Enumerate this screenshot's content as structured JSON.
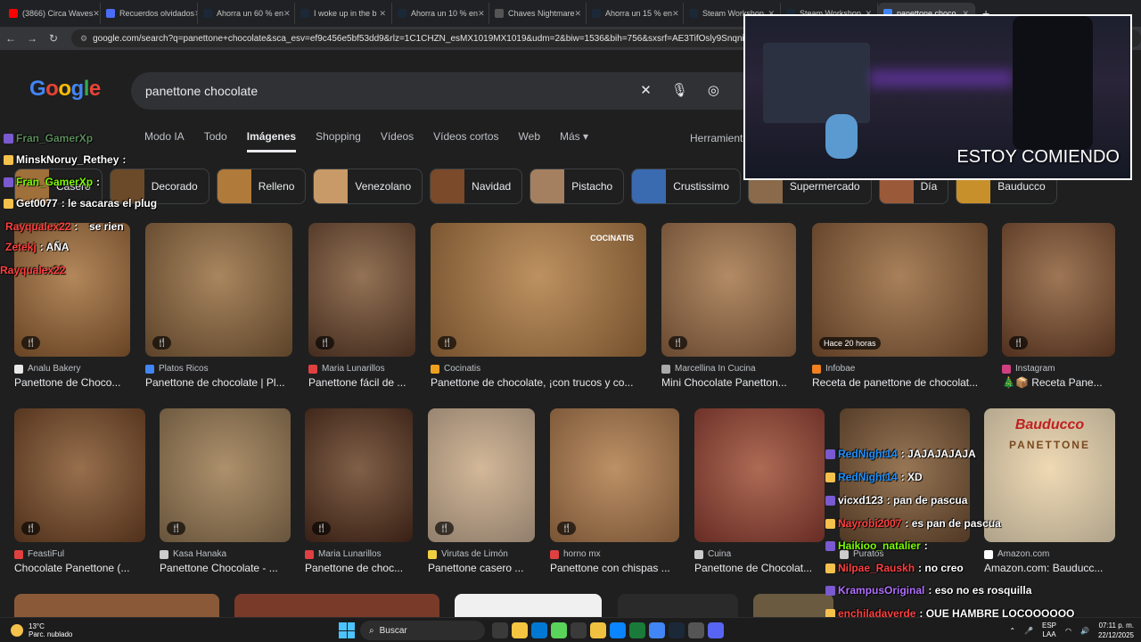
{
  "browser": {
    "tabs": [
      {
        "label": "(3866) Circa Waves",
        "color": "#ff0000"
      },
      {
        "label": "Recuerdos olvidados",
        "color": "#4a6cf7"
      },
      {
        "label": "Ahorra un 60 % en",
        "color": "#1b2838"
      },
      {
        "label": "I woke up in the b",
        "color": "#1b2838"
      },
      {
        "label": "Ahorra un 10 % en",
        "color": "#1b2838"
      },
      {
        "label": "Chaves Nightmare",
        "color": "#555555"
      },
      {
        "label": "Ahorra un 15 % en",
        "color": "#1b2838"
      },
      {
        "label": "Steam Workshop",
        "color": "#1b2838"
      },
      {
        "label": "Steam Workshop",
        "color": "#1b2838"
      },
      {
        "label": "panettone choco",
        "color": "#4285f4"
      }
    ],
    "url": "google.com/search?q=panettone+chocolate&sca_esv=ef9c456e5bf53dd9&rlz=1C1CHZN_esMX1019MX1019&udm=2&biw=1536&bih=756&sxsrf=AE3TifOsly9SnqnipYulXe1Eus"
  },
  "google": {
    "logo": "Google",
    "query": "panettone chocolate",
    "tabs": [
      "Modo IA",
      "Todo",
      "Imágenes",
      "Shopping",
      "Vídeos",
      "Vídeos cortos",
      "Web",
      "Más ▾"
    ],
    "tools": "Herramientas",
    "chips": [
      {
        "label": "Casero",
        "color": "#a0703a"
      },
      {
        "label": "Decorado",
        "color": "#6b4a2a"
      },
      {
        "label": "Relleno",
        "color": "#b07a3a"
      },
      {
        "label": "Venezolano",
        "color": "#c89a68"
      },
      {
        "label": "Navidad",
        "color": "#7a4a2a"
      },
      {
        "label": "Pistacho",
        "color": "#a48060"
      },
      {
        "label": "Crustissimo",
        "color": "#3a6ab0"
      },
      {
        "label": "Supermercado",
        "color": "#8a6a4a"
      },
      {
        "label": "Día",
        "color": "#9a5a3a"
      },
      {
        "label": "Bauducco",
        "color": "#c8902a"
      }
    ],
    "row1": [
      {
        "source": "Analu Bakery",
        "title": "Panettone de Choco...",
        "color": "#8a5a30",
        "src_color": "#e8e8e8",
        "badge": ""
      },
      {
        "source": "Platos Ricos",
        "title": "Panettone de chocolate | Pl...",
        "color": "#7a5836",
        "src_color": "#4285f4",
        "badge": ""
      },
      {
        "source": "Maria Lunarillos",
        "title": "Panettone fácil de ...",
        "color": "#5a3a28",
        "src_color": "#e04040",
        "badge": ""
      },
      {
        "source": "Cocinatis",
        "title": "Panettone de chocolate, ¡con trucos y co...",
        "color": "#9a6a3a",
        "src_color": "#f0a020",
        "badge": ""
      },
      {
        "source": "Marcellina In Cucina",
        "title": "Mini Chocolate Panetton...",
        "color": "#8a6040",
        "src_color": "#aaaaaa",
        "badge": ""
      },
      {
        "source": "Infobae",
        "title": "Receta de panettone de chocolat...",
        "color": "#7a5030",
        "src_color": "#f08020",
        "badge": "Hace 20 horas"
      },
      {
        "source": "Instagram",
        "title": "🎄📦 Receta Pane...",
        "color": "#6a4028",
        "src_color": "#d04080",
        "badge": ""
      }
    ],
    "row2": [
      {
        "source": "FeastiFul",
        "title": "Chocolate Panettone (...",
        "color": "#6a4024",
        "src_color": "#e04040"
      },
      {
        "source": "Kasa Hanaka",
        "title": "Panettone Chocolate - ...",
        "color": "#8a7050",
        "src_color": "#cccccc"
      },
      {
        "source": "Maria Lunarillos",
        "title": "Panettone de choc...",
        "color": "#4a2a1c",
        "src_color": "#e04040"
      },
      {
        "source": "Virutas de Limón",
        "title": "Panettone casero ...",
        "color": "#c0a890",
        "src_color": "#f0d040"
      },
      {
        "source": "horno mx",
        "title": "Panettone con chispas ...",
        "color": "#a07048",
        "src_color": "#e04040"
      },
      {
        "source": "Cuina",
        "title": "Panettone de Chocolat...",
        "color": "#8a3a30",
        "src_color": "#cccccc"
      },
      {
        "source": "Puratos",
        "title": "",
        "color": "#6a4a30",
        "src_color": "#cccccc"
      },
      {
        "source": "Amazon.com",
        "title": "Amazon.com: Bauducc...",
        "color": "#e8d8b8",
        "src_color": "#ffffff"
      }
    ],
    "bauducco_brand": "Bauducco",
    "bauducco_product": "PANETTONE",
    "cocinatis_watermark": "COCINATIS"
  },
  "chat": [
    {
      "user": "Fran_GamerXp",
      "msg": "",
      "color": "#5a8a5a"
    },
    {
      "user": "MinskNoruy_Rethey",
      "msg": ":",
      "color": "#ffffff"
    },
    {
      "user": "Fran_GamerXp",
      "msg": ":",
      "color": "#7cfc00"
    },
    {
      "user": "Get0077",
      "msg": ": le sacaras el plug",
      "color": "#ffffff"
    },
    {
      "user": "Rayqualex22",
      "msg": ":",
      "color": "#ff4040"
    },
    {
      "user": "",
      "msg": "se rien",
      "color": "#ffffff"
    },
    {
      "user": "Zetekj",
      "msg": ": AÑA",
      "color": "#ff4040"
    },
    {
      "user": "Rayqualex22",
      "msg": "",
      "color": "#ff4040"
    },
    {
      "user": "RedNight14",
      "msg": ": JAJAJAJAJA",
      "color": "#1e90ff"
    },
    {
      "user": "RedNight14",
      "msg": ": XD",
      "color": "#1e90ff"
    },
    {
      "user": "vicxd123",
      "msg": ": pan de pascua",
      "color": "#ffffff"
    },
    {
      "user": "Nayrobi2007",
      "msg": ": es pan de pascua",
      "color": "#ff4040"
    },
    {
      "user": "Haikioo_natalier",
      "msg": ":",
      "color": "#7cfc00"
    },
    {
      "user": "Nilpae_Rauskh",
      "msg": ": no creo",
      "color": "#ff4040"
    },
    {
      "user": "KrampusOriginal",
      "msg": ": eso no es rosquilla",
      "color": "#b070ff"
    },
    {
      "user": "enchiladaverde",
      "msg": ": QUE HAMBRE LOCOOOOOO",
      "color": "#ff4040"
    }
  ],
  "webcam": {
    "caption": "ESTOY COMIENDO"
  },
  "taskbar": {
    "temp": "13°C",
    "weather": "Parc. nublado",
    "search": "Buscar",
    "apps": [
      "#3a3a3a",
      "#f5c542",
      "#0078d4",
      "#5ad35a",
      "#3a3a3a",
      "#f0c040",
      "#0a84ff",
      "#1a7a3a",
      "#4285f4",
      "#1b2838",
      "#555555",
      "#5865f2"
    ],
    "lang1": "ESP",
    "lang2": "LAA",
    "time": "07:11 p. m.",
    "date": "22/12/2025"
  }
}
